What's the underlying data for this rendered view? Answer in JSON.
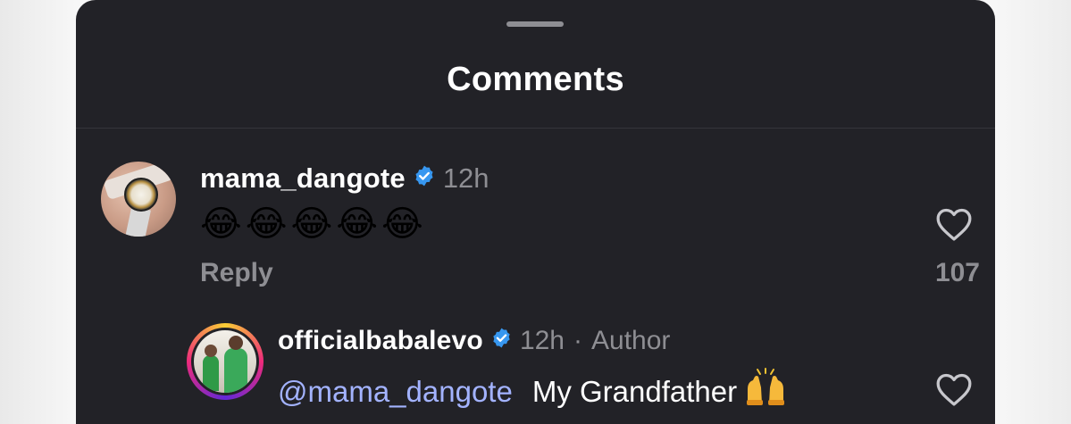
{
  "sheet": {
    "title": "Comments"
  },
  "comments": [
    {
      "username": "mama_dangote",
      "verified": true,
      "time": "12h",
      "text": "😂😂😂😂😂",
      "reply_label": "Reply",
      "like_count": "107",
      "icons": {
        "avatar": "avatar-photo",
        "verified": "verified-badge-icon",
        "like": "heart-outline-icon"
      }
    }
  ],
  "replies": [
    {
      "username": "officialbabalevo",
      "verified": true,
      "time": "12h",
      "separator": "·",
      "role": "Author",
      "mention": "@mama_dangote",
      "text": "My Grandfather",
      "emoji_icon": "raising-hands-icon",
      "icons": {
        "avatar": "avatar-photo-story-ring",
        "verified": "verified-badge-icon",
        "like": "heart-outline-icon"
      }
    }
  ],
  "colors": {
    "sheet_bg": "#222227",
    "text_primary": "#ffffff",
    "text_secondary": "#8e8e93",
    "mention": "#a3b3ff",
    "verified": "#3797f0"
  }
}
